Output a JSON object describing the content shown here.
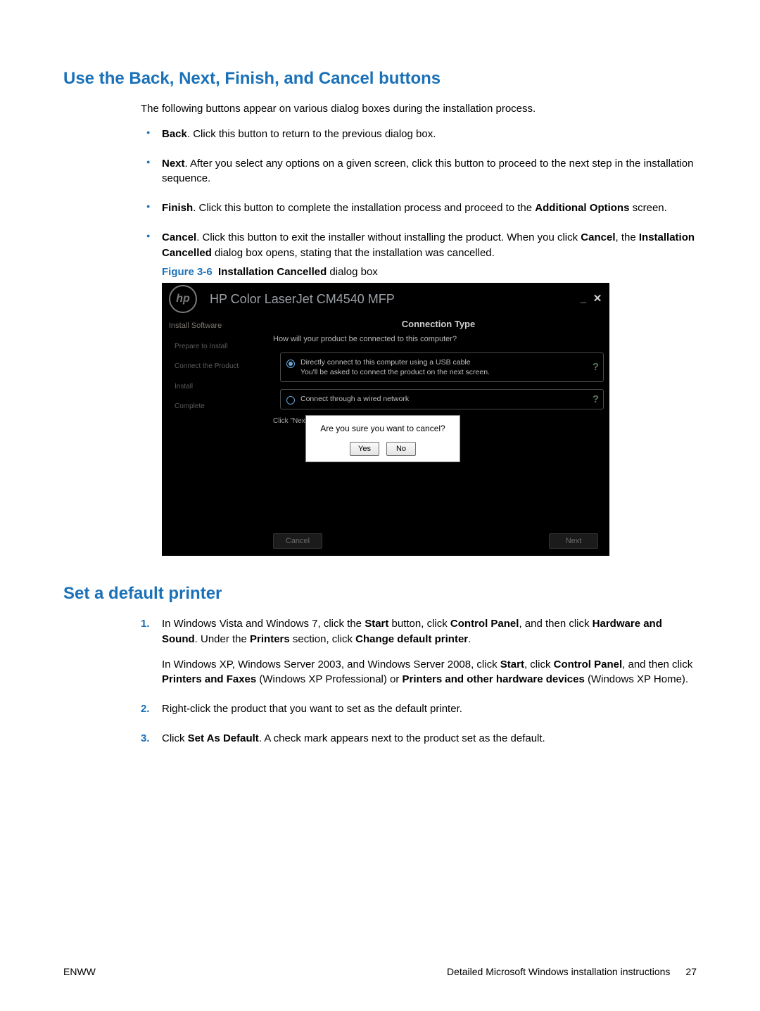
{
  "heading1": "Use the Back, Next, Finish, and Cancel buttons",
  "intro": "The following buttons appear on various dialog boxes during the installation process.",
  "bullets": {
    "back_bold": "Back",
    "back_rest": ". Click this button to return to the previous dialog box.",
    "next_bold": "Next",
    "next_rest": ". After you select any options on a given screen, click this button to proceed to the next step in the installation sequence.",
    "finish_bold": "Finish",
    "finish_mid": ". Click this button to complete the installation process and proceed to the ",
    "finish_bold2": "Additional Options",
    "finish_rest": " screen.",
    "cancel_bold": "Cancel",
    "cancel_mid": ". Click this button to exit the installer without installing the product. When you click ",
    "cancel_bold2": "Cancel",
    "cancel_mid2": ", the ",
    "cancel_bold3": "Installation Cancelled",
    "cancel_rest": " dialog box opens, stating that the installation was cancelled."
  },
  "figure": {
    "label": "Figure 3-6",
    "bold": "Installation Cancelled",
    "suffix": " dialog box"
  },
  "shot": {
    "logo": "hp",
    "title": "HP Color LaserJet CM4540 MFP",
    "nav_title": "Install Software",
    "steps": [
      "Prepare to Install",
      "Connect the Product",
      "Install",
      "Complete"
    ],
    "conn_title": "Connection Type",
    "conn_sub": "How will your product be connected to this computer?",
    "opt1_line1": "Directly connect to this computer using a USB cable",
    "opt1_line2": "You'll be asked to connect the product on the next screen.",
    "opt2": "Connect through a wired network",
    "clicknext": "Click \"Next",
    "confirm_msg": "Are you sure you want to cancel?",
    "yes": "Yes",
    "no": "No",
    "cancel_btn": "Cancel",
    "next_btn": "Next"
  },
  "heading2": "Set a default printer",
  "steps": {
    "s1a": "In Windows Vista and Windows 7, click the ",
    "s1b": "Start",
    "s1c": " button, click ",
    "s1d": "Control Panel",
    "s1e": ", and then click ",
    "s1f": "Hardware and Sound",
    "s1g": ". Under the ",
    "s1h": "Printers",
    "s1i": " section, click ",
    "s1j": "Change default printer",
    "s1k": ".",
    "s1p2a": "In Windows XP, Windows Server 2003, and Windows Server 2008, click ",
    "s1p2b": "Start",
    "s1p2c": ", click ",
    "s1p2d": "Control Panel",
    "s1p2e": ", and then click ",
    "s1p2f": "Printers and Faxes",
    "s1p2g": " (Windows XP Professional) or ",
    "s1p2h": "Printers and other hardware devices",
    "s1p2i": " (Windows XP Home).",
    "s2": "Right-click the product that you want to set as the default printer.",
    "s3a": "Click ",
    "s3b": "Set As Default",
    "s3c": ". A check mark appears next to the product set as the default."
  },
  "footer": {
    "left": "ENWW",
    "center": "Detailed Microsoft Windows installation instructions",
    "page": "27"
  }
}
